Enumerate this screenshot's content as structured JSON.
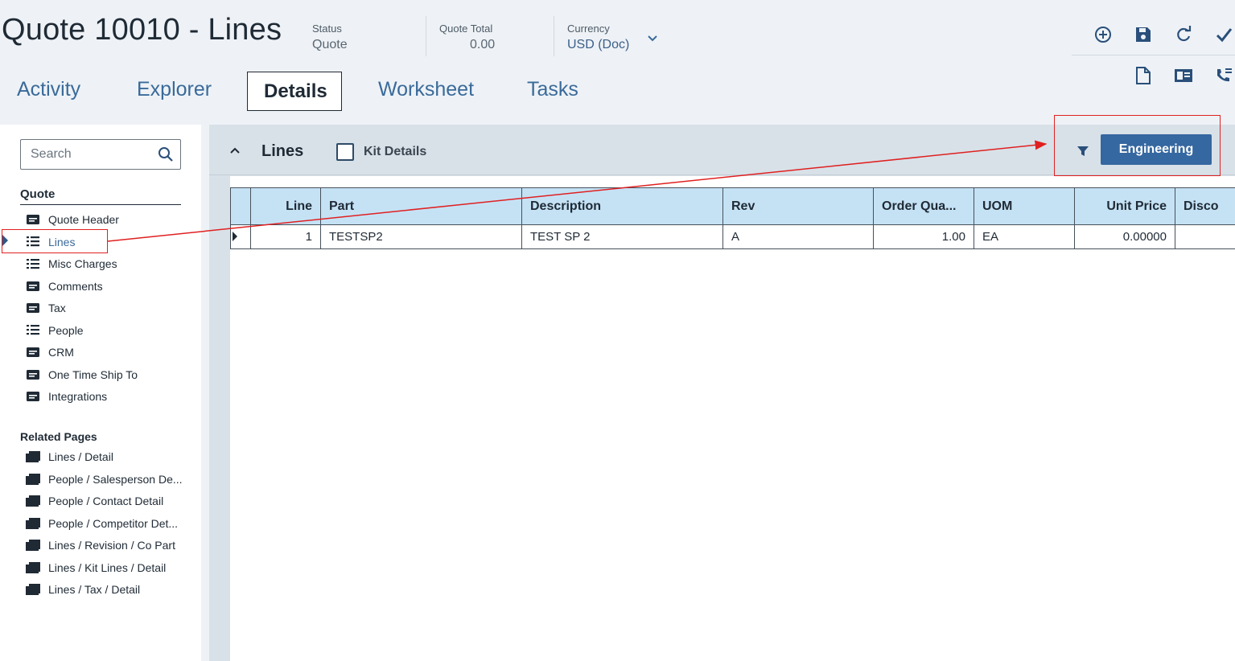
{
  "header": {
    "title": "Quote 10010 - Lines",
    "status_label": "Status",
    "status_value": "Quote",
    "total_label": "Quote Total",
    "total_value": "0.00",
    "currency_label": "Currency",
    "currency_value": "USD (Doc)"
  },
  "tabs": [
    {
      "label": "Activity"
    },
    {
      "label": "Explorer"
    },
    {
      "label": "Details"
    },
    {
      "label": "Worksheet"
    },
    {
      "label": "Tasks"
    }
  ],
  "active_tab": "Details",
  "toolbar": {
    "icons": [
      "add-icon",
      "save-icon",
      "refresh-icon",
      "clear-icon",
      "new-page-icon",
      "view-icon",
      "phone-list-icon"
    ]
  },
  "nav": {
    "search_placeholder": "Search",
    "quote_section": "Quote",
    "quote_items": [
      {
        "label": "Quote Header",
        "icon": "card-icon"
      },
      {
        "label": "Lines",
        "icon": "list-icon"
      },
      {
        "label": "Misc Charges",
        "icon": "list-icon"
      },
      {
        "label": "Comments",
        "icon": "card-icon"
      },
      {
        "label": "Tax",
        "icon": "card-icon"
      },
      {
        "label": "People",
        "icon": "list-icon"
      },
      {
        "label": "CRM",
        "icon": "card-icon"
      },
      {
        "label": "One Time Ship To",
        "icon": "card-icon"
      },
      {
        "label": "Integrations",
        "icon": "card-icon"
      }
    ],
    "selected_item": "Lines",
    "related_section": "Related Pages",
    "related_items": [
      {
        "label": "Lines / Detail"
      },
      {
        "label": "People / Salesperson De..."
      },
      {
        "label": "People / Contact Detail"
      },
      {
        "label": "People / Competitor Det..."
      },
      {
        "label": "Lines / Revision / Co Part"
      },
      {
        "label": "Lines / Kit Lines / Detail"
      },
      {
        "label": "Lines / Tax / Detail"
      }
    ]
  },
  "panel": {
    "title": "Lines",
    "kit_details_label": "Kit Details",
    "kit_details_checked": false,
    "engineering_button": "Engineering"
  },
  "grid": {
    "columns": [
      "Line",
      "Part",
      "Description",
      "Rev",
      "Order Qua...",
      "UOM",
      "Unit Price",
      "Disco"
    ],
    "rows": [
      {
        "line": "1",
        "part": "TESTSP2",
        "description": "TEST SP 2",
        "rev": "A",
        "order_qty": "1.00",
        "uom": "EA",
        "unit_price": "0.00000",
        "disc": ""
      }
    ]
  },
  "colors": {
    "accent": "#3567a0",
    "grid_header": "#c5e2f5",
    "annotation": "#e02020",
    "link": "#3a6a9a"
  }
}
